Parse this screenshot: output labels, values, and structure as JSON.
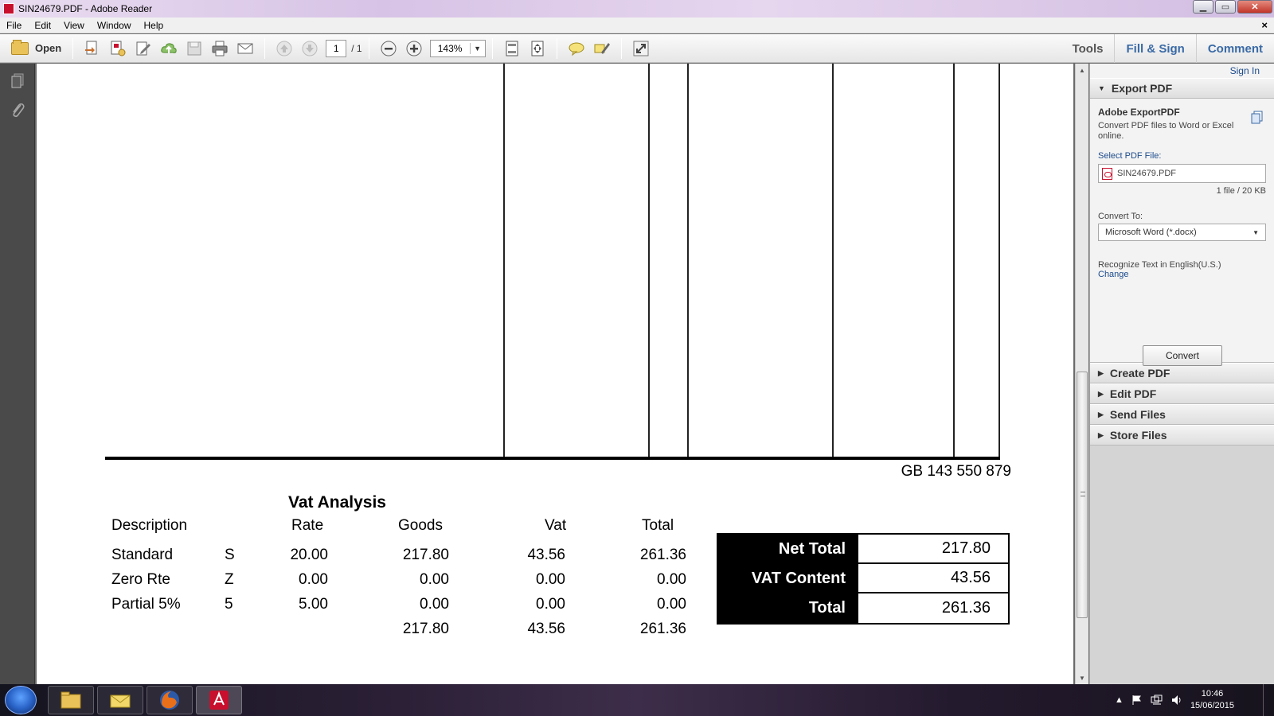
{
  "window": {
    "title": "SIN24679.PDF - Adobe Reader",
    "controls": {
      "minimize": "▁",
      "maximize": "▭",
      "close": "✕"
    },
    "doc_close": "×"
  },
  "menubar": {
    "items": [
      "File",
      "Edit",
      "View",
      "Window",
      "Help"
    ]
  },
  "toolbar": {
    "open_label": "Open",
    "page_current": "1",
    "page_total": "/ 1",
    "zoom": "143%",
    "tabs": [
      "Tools",
      "Fill & Sign",
      "Comment"
    ]
  },
  "document": {
    "vat_reg": "GB 143 550 879",
    "vat_title": "Vat Analysis",
    "headers": {
      "description": "Description",
      "rate": "Rate",
      "goods": "Goods",
      "vat": "Vat",
      "total": "Total"
    },
    "rows": [
      {
        "description": "Standard",
        "code": "S",
        "rate": "20.00",
        "goods": "217.80",
        "vat": "43.56",
        "total": "261.36"
      },
      {
        "description": "Zero Rte",
        "code": "Z",
        "rate": "0.00",
        "goods": "0.00",
        "vat": "0.00",
        "total": "0.00"
      },
      {
        "description": "Partial 5%",
        "code": "5",
        "rate": "5.00",
        "goods": "0.00",
        "vat": "0.00",
        "total": "0.00"
      }
    ],
    "sum": {
      "goods": "217.80",
      "vat": "43.56",
      "total": "261.36"
    },
    "totals": [
      {
        "label": "Net Total",
        "value": "217.80"
      },
      {
        "label": "VAT Content",
        "value": "43.56"
      },
      {
        "label": "Total",
        "value": "261.36"
      }
    ]
  },
  "right_panel": {
    "sign_in": "Sign In",
    "export_header": "Export PDF",
    "export_title": "Adobe ExportPDF",
    "export_desc": "Convert PDF files to Word or Excel online.",
    "select_label": "Select PDF File:",
    "file_name": "SIN24679.PDF",
    "file_meta": "1 file / 20 KB",
    "convert_to_label": "Convert To:",
    "convert_to_value": "Microsoft Word (*.docx)",
    "recognize_text": "Recognize Text in English(U.S.)",
    "change_link": "Change",
    "convert_button": "Convert",
    "sections": [
      "Create PDF",
      "Edit PDF",
      "Send Files",
      "Store Files"
    ]
  },
  "taskbar": {
    "time": "10:46",
    "date": "15/06/2015"
  },
  "colors": {
    "accent_blue": "#3a6aa6",
    "link_blue": "#1c4b8c",
    "pdf_red": "#c8102e"
  }
}
